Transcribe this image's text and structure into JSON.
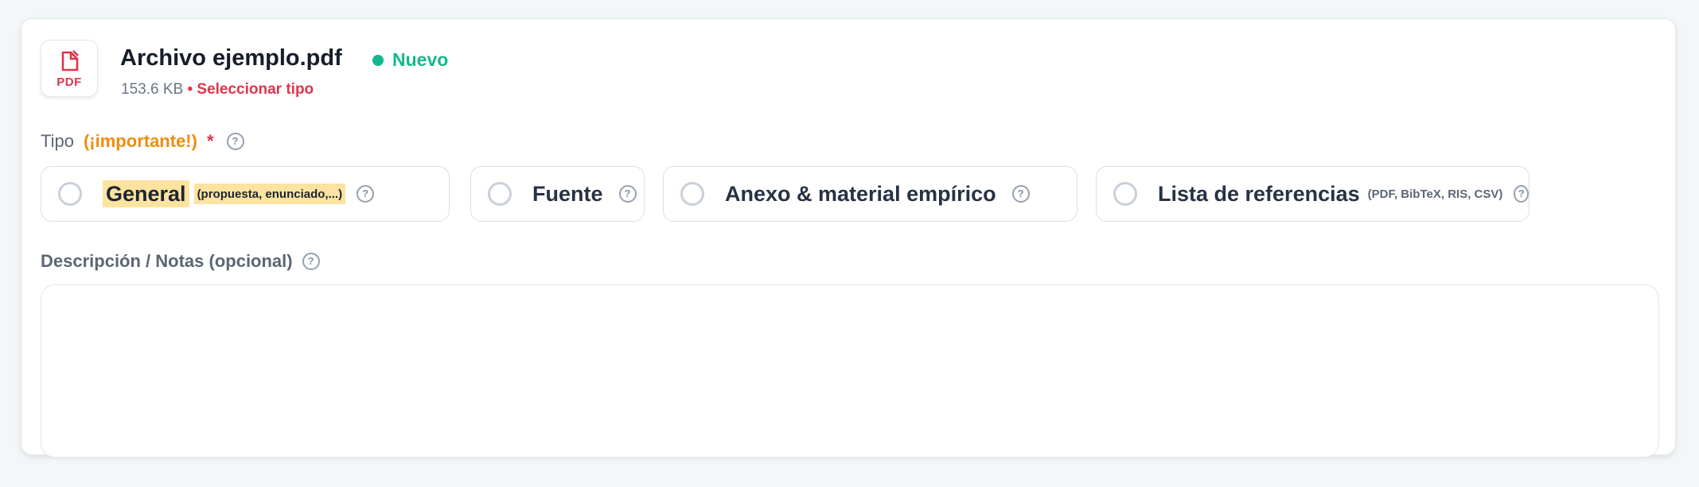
{
  "file": {
    "name": "Archivo ejemplo.pdf",
    "icon_label": "PDF",
    "status": "Nuevo",
    "size": "153.6 KB",
    "separator": "•",
    "action": "Seleccionar tipo"
  },
  "type_field": {
    "label": "Tipo",
    "important": "(¡importante!)",
    "required_mark": "*",
    "help": "?",
    "options": [
      {
        "name": "General",
        "note": "(propuesta, enunciado,...)",
        "help": "?"
      },
      {
        "name": "Fuente",
        "note": "",
        "help": "?"
      },
      {
        "name": "Anexo & material empírico",
        "note": "",
        "help": "?"
      },
      {
        "name": "Lista de referencias",
        "note": "(PDF, BibTeX, RIS, CSV)",
        "help": "?"
      }
    ]
  },
  "description_field": {
    "label": "Descripción / Notas (opcional)",
    "help": "?",
    "value": ""
  },
  "colors": {
    "accent_red": "#e0344b",
    "status_green": "#14b88a",
    "important_orange": "#f08c0c",
    "highlight_yellow": "#fde3a0"
  },
  "icons": [
    "pdf-file-icon",
    "status-dot-icon",
    "help-icon",
    "radio-icon"
  ]
}
